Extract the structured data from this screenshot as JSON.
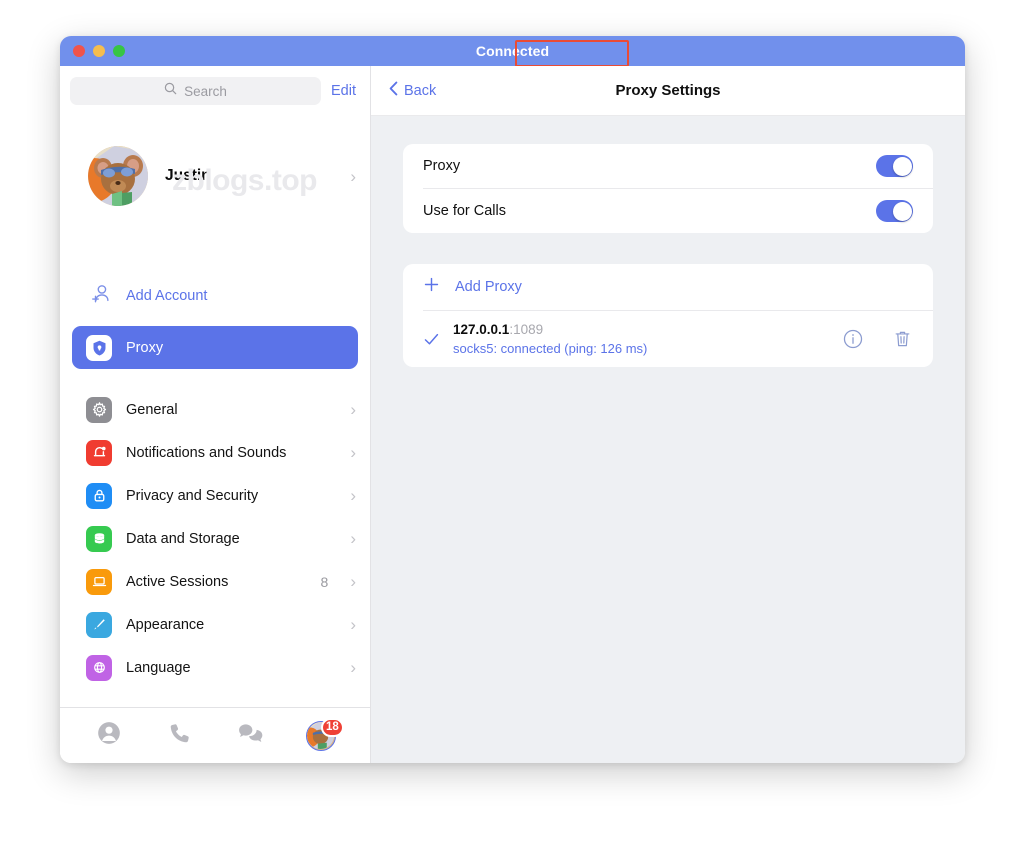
{
  "window": {
    "title": "Connected",
    "traffic_lights": [
      "close-button",
      "minimize-button",
      "zoom-button"
    ]
  },
  "sidebar": {
    "search": {
      "placeholder": "Search",
      "value": "",
      "icon": "search-icon"
    },
    "edit_label": "Edit",
    "profile": {
      "name": "Justin",
      "avatar_icon": "user-avatar",
      "chevron": "›",
      "watermark": "zblogs.top"
    },
    "add_account": {
      "label": "Add Account",
      "icon": "add-person-icon"
    },
    "selected_item": {
      "label": "Proxy",
      "icon": "shield-icon",
      "accent": "#5b73e8"
    },
    "items": [
      {
        "label": "General",
        "icon": "gear-icon",
        "color": "#8e8e93",
        "count": "",
        "chevron": "›"
      },
      {
        "label": "Notifications and Sounds",
        "icon": "bell-icon",
        "color": "#f03c30",
        "count": "",
        "chevron": "›"
      },
      {
        "label": "Privacy and Security",
        "icon": "lock-icon",
        "color": "#1f8df5",
        "count": "",
        "chevron": "›"
      },
      {
        "label": "Data and Storage",
        "icon": "database-icon",
        "color": "#36ca50",
        "count": "",
        "chevron": "›"
      },
      {
        "label": "Active Sessions",
        "icon": "laptop-icon",
        "color": "#f99a0b",
        "count": "8",
        "chevron": "›"
      },
      {
        "label": "Appearance",
        "icon": "paintbrush-icon",
        "color": "#3aa8e0",
        "count": "",
        "chevron": "›"
      },
      {
        "label": "Language",
        "icon": "globe-icon",
        "color": "#c063e5",
        "count": "",
        "chevron": "›"
      }
    ],
    "tabbar": {
      "tabs": [
        {
          "icon": "contacts-icon",
          "label": "Contacts"
        },
        {
          "icon": "phone-icon",
          "label": "Calls"
        },
        {
          "icon": "chat-bubbles-icon",
          "label": "Chats"
        },
        {
          "icon": "account-avatar-icon",
          "label": "Account",
          "badge": "18"
        }
      ]
    }
  },
  "main": {
    "back_label": "Back",
    "back_icon": "chevron-left-icon",
    "title": "Proxy Settings",
    "toggles": [
      {
        "label": "Proxy",
        "on": true
      },
      {
        "label": "Use for Calls",
        "on": true
      }
    ],
    "add_proxy": {
      "label": "Add Proxy",
      "icon": "plus-icon"
    },
    "proxies": [
      {
        "selected": true,
        "check_icon": "check-icon",
        "host": "127.0.0.1",
        "port": ":1089",
        "status": "socks5: connected (ping: 126 ms)",
        "info_icon": "info-icon",
        "delete_icon": "trash-icon"
      }
    ]
  },
  "colors": {
    "accent": "#5b73e8",
    "titlebar": "#7190ec",
    "annotation": "#ea4b35",
    "content_bg": "#eef0f3",
    "badge_red": "#ef4136"
  }
}
